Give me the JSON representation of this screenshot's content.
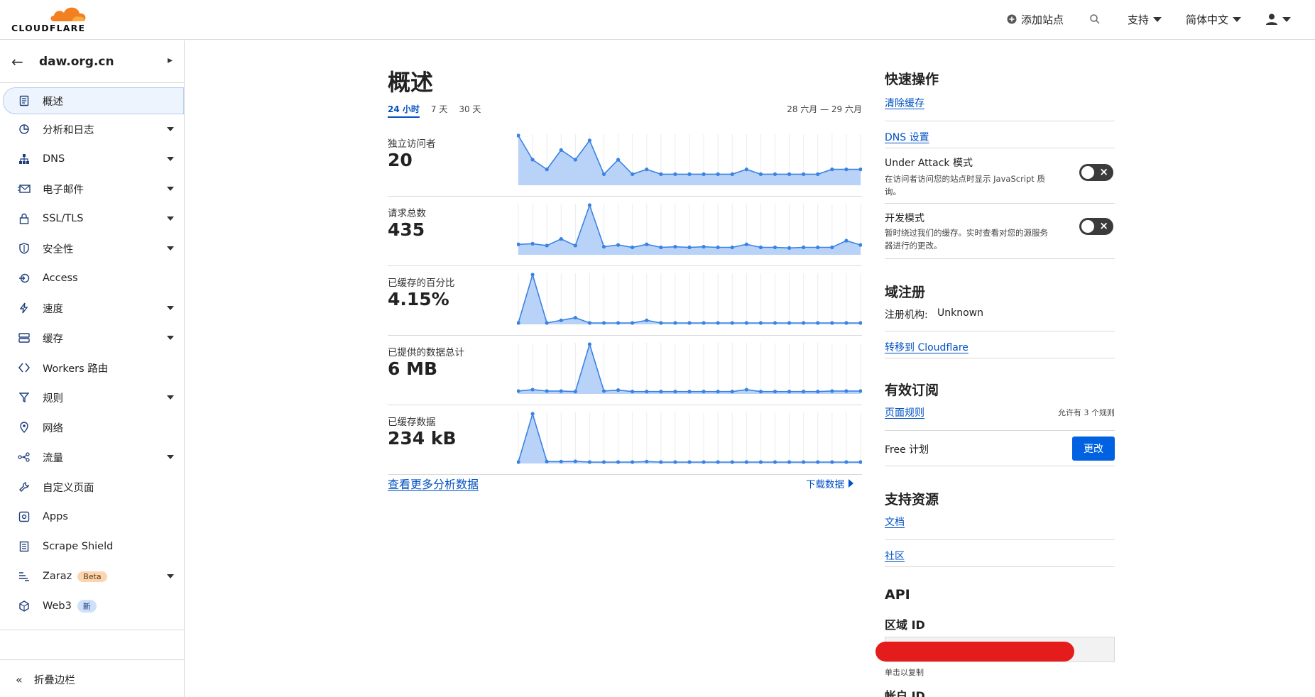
{
  "header": {
    "logo_text": "CLOUDFLARE",
    "add_site": "添加站点",
    "support": "支持",
    "language": "简体中文"
  },
  "sidebar": {
    "zone_name": "daw.org.cn",
    "items": [
      {
        "label": "概述",
        "icon": "document-icon",
        "caret": false,
        "active": true
      },
      {
        "label": "分析和日志",
        "icon": "analytics-icon",
        "caret": true
      },
      {
        "label": "DNS",
        "icon": "dns-icon",
        "caret": true
      },
      {
        "label": "电子邮件",
        "icon": "email-icon",
        "caret": true
      },
      {
        "label": "SSL/TLS",
        "icon": "lock-icon",
        "caret": true
      },
      {
        "label": "安全性",
        "icon": "shield-icon",
        "caret": true
      },
      {
        "label": "Access",
        "icon": "access-icon",
        "caret": false
      },
      {
        "label": "速度",
        "icon": "bolt-icon",
        "caret": true
      },
      {
        "label": "缓存",
        "icon": "cache-icon",
        "caret": true
      },
      {
        "label": "Workers 路由",
        "icon": "workers-icon",
        "caret": false
      },
      {
        "label": "规则",
        "icon": "rules-icon",
        "caret": true
      },
      {
        "label": "网络",
        "icon": "location-pin-icon",
        "caret": false
      },
      {
        "label": "流量",
        "icon": "traffic-icon",
        "caret": true
      },
      {
        "label": "自定义页面",
        "icon": "wrench-icon",
        "caret": false
      },
      {
        "label": "Apps",
        "icon": "apps-icon",
        "caret": false
      },
      {
        "label": "Scrape Shield",
        "icon": "scrape-shield-icon",
        "caret": false
      },
      {
        "label": "Zaraz",
        "icon": "zaraz-icon",
        "caret": true,
        "badge": "Beta"
      },
      {
        "label": "Web3",
        "icon": "web3-icon",
        "caret": false,
        "badge": "新"
      }
    ],
    "collapse_label": "折叠边栏"
  },
  "overview": {
    "title": "概述",
    "tabs": [
      "24 小时",
      "7 天",
      "30 天"
    ],
    "active_tab": "24 小时",
    "date_range": "28 六月 — 29 六月",
    "metrics": [
      {
        "label": "独立访问者",
        "value": "20"
      },
      {
        "label": "请求总数",
        "value": "435"
      },
      {
        "label": "已缓存的百分比",
        "value": "4.15%"
      },
      {
        "label": "已提供的数据总计",
        "value": "6 MB"
      },
      {
        "label": "已缓存数据",
        "value": "234 kB"
      }
    ],
    "more_link": "查看更多分析数据",
    "download": "下载数据"
  },
  "chart_data": [
    {
      "type": "area",
      "title": "独立访问者",
      "values": [
        10,
        5,
        3,
        7,
        5,
        9,
        2,
        5,
        2,
        3,
        2,
        2,
        2,
        2,
        2,
        2,
        3,
        2,
        2,
        2,
        2,
        2,
        3,
        3,
        3
      ]
    },
    {
      "type": "area",
      "title": "请求总数",
      "values": [
        30,
        32,
        26,
        48,
        26,
        160,
        22,
        28,
        20,
        30,
        20,
        22,
        20,
        22,
        20,
        20,
        30,
        20,
        20,
        18,
        20,
        20,
        20,
        42,
        28
      ]
    },
    {
      "type": "area",
      "title": "已缓存的百分比",
      "values": [
        0,
        55,
        0,
        3,
        6,
        0,
        0,
        0,
        0,
        3,
        0,
        0,
        0,
        0,
        0,
        0,
        0,
        0,
        0,
        0,
        0,
        0,
        0,
        0,
        0
      ]
    },
    {
      "type": "area",
      "title": "已提供的数据总计",
      "values": [
        3,
        6,
        3,
        3,
        2,
        100,
        3,
        5,
        2,
        2,
        2,
        2,
        2,
        2,
        2,
        2,
        6,
        2,
        2,
        2,
        2,
        2,
        3,
        3,
        3
      ]
    },
    {
      "type": "area",
      "title": "已缓存数据",
      "values": [
        0,
        100,
        1,
        1,
        1.5,
        0,
        0,
        0,
        0,
        1,
        0,
        0,
        0,
        0,
        0,
        0,
        0,
        0,
        0,
        0,
        0,
        0,
        0,
        0,
        0
      ]
    }
  ],
  "quick_actions": {
    "title": "快速操作",
    "purge_cache": "清除缓存",
    "dns_settings": "DNS 设置",
    "under_attack_title": "Under Attack 模式",
    "under_attack_desc": "在访问者访问您的站点时显示 JavaScript 质询。",
    "dev_mode_title": "开发模式",
    "dev_mode_desc": "暂时绕过我们的缓存。实时查看对您的源服务器进行的更改。"
  },
  "registration": {
    "title": "域注册",
    "registrar_label": "注册机构:",
    "registrar_value": "Unknown",
    "transfer_link": "转移到 Cloudflare"
  },
  "subscriptions": {
    "title": "有效订阅",
    "page_rules": "页面规则",
    "page_rules_allow": "允许有 3 个规则",
    "plan": "Free 计划",
    "upgrade": "更改"
  },
  "support_resources": {
    "title": "支持资源",
    "docs": "文档",
    "community": "社区"
  },
  "api": {
    "title": "API",
    "zone_id_label": "区域 ID",
    "click_to_copy": "单击以复制",
    "account_id_label": "帐户 ID"
  },
  "colors": {
    "accent": "#0051c3",
    "chart_line": "#3a82e3",
    "chart_fill": "#b8d3f7",
    "redaction": "#e51c1c"
  }
}
